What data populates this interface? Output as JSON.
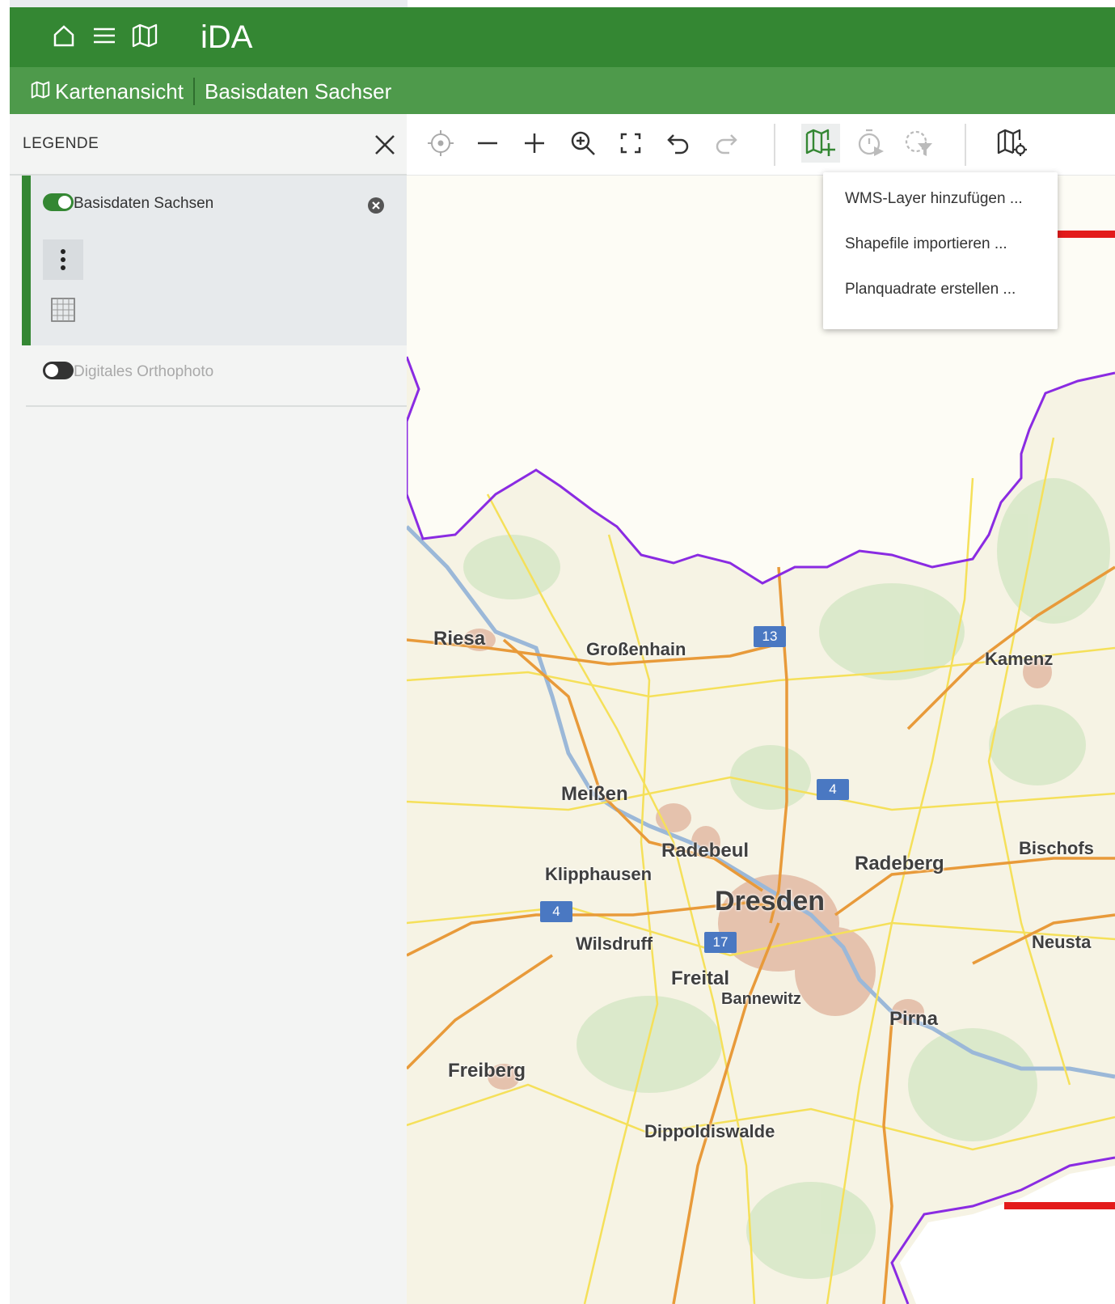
{
  "header": {
    "app_title": "iDA",
    "icons": [
      "home-icon",
      "menu-icon",
      "map-icon"
    ]
  },
  "breadcrumb": {
    "items": [
      "Kartenansicht",
      "Basisdaten Sachser"
    ]
  },
  "legend": {
    "title": "LEGENDE",
    "layers": [
      {
        "name": "Basisdaten Sachsen",
        "enabled": true
      },
      {
        "name": "Digitales Orthophoto",
        "enabled": false
      }
    ]
  },
  "toolbar": {
    "buttons": [
      "locate",
      "zoom-out",
      "zoom-in",
      "zoom-to",
      "fullscreen",
      "undo",
      "redo",
      "add-layer",
      "time",
      "filter",
      "map-settings"
    ],
    "active": "add-layer"
  },
  "dropdown": {
    "items": [
      "WMS-Layer hinzufügen ...",
      "Shapefile importieren ...",
      "Planquadrate erstellen ..."
    ]
  },
  "map": {
    "places": [
      "Riesa",
      "Großenhain",
      "Kamenz",
      "Meißen",
      "Radebeul",
      "Radeberg",
      "Bischofs",
      "Klipphausen",
      "Dresden",
      "Wilsdruff",
      "Neusta",
      "Freital",
      "Bannewitz",
      "Pirna",
      "Freiberg",
      "Dippoldiswalde"
    ],
    "roads": [
      "13",
      "4",
      "4",
      "17"
    ]
  },
  "colors": {
    "primary": "#348733",
    "secondary": "#4e9a4b",
    "border": "#8a2be2",
    "highlight": "#e31b1b"
  }
}
